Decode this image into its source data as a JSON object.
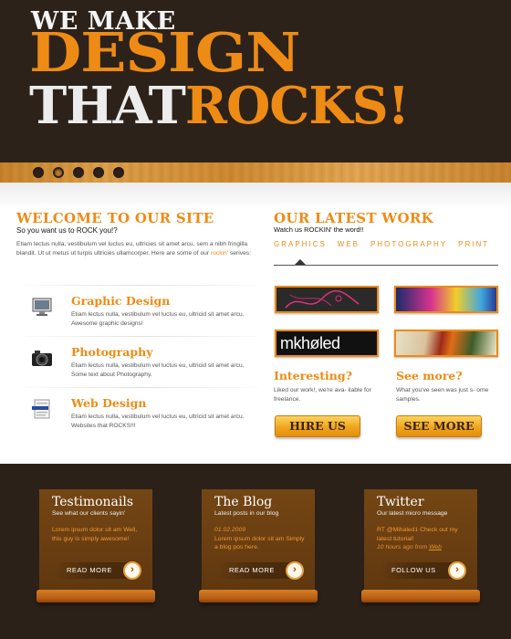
{
  "hero": {
    "line1": "WE MAKE",
    "line2": "DESIGN",
    "line3_white": "THAT",
    "line3_orange": "ROCKS!"
  },
  "slider": {
    "dots": 5,
    "active": 2
  },
  "welcome": {
    "title": "WELCOME TO OUR SITE",
    "subtitle": "So you want us to ROCK you!?",
    "body1": "Etiam lectus nulla, vestibulum vel luctus eu, ultricies sit amet arcu. sem a nibh fringilla blandit. Ut ut metus ut turpis ultricies ullamcorper. Here are some of our ",
    "body_rock": "rockin'",
    "body2": " serives:"
  },
  "services": [
    {
      "title": "Graphic Design",
      "desc": "Etiam lectus nulla, vestibulum vel luctus eu, ultricid sit amet arcu. Awesome graphic designs!",
      "icon": "monitor-icon"
    },
    {
      "title": "Photography",
      "desc": "Etiam lectus nulla, vestibulum vel luctus eu, ultricid sit amet arcu. Some text about Photography.",
      "icon": "camera-icon"
    },
    {
      "title": "Web Design",
      "desc": "Etiam lectus nulla, vestibulum vel luctus eu, ultricid sit amet arcu. Websites that ROCKS!!!",
      "icon": "webpage-icon"
    }
  ],
  "work": {
    "title": "OUR LATEST WORK",
    "subtitle": "Watch us ROCKIN' the word!!",
    "tabs": [
      "GRAPHICS",
      "WEB",
      "PHOTOGRAPHY",
      "PRINT"
    ],
    "active_tab": 0,
    "thumb3_text": "mkhøled"
  },
  "interesting": {
    "title": "Interesting?",
    "desc": "Liked our work!, we're ava- ilable for freelance.",
    "button": "HIRE US"
  },
  "seemore": {
    "title": "See more?",
    "desc": "What you've seen was just s- ome samples.",
    "button": "SEE MORE"
  },
  "footer": {
    "testimonials": {
      "title": "Testimonails",
      "subtitle": "See what our clients sayin'",
      "body": "Lorem ipsum dolor sit am Well, this guy is simply awesome!",
      "button": "READ MORE"
    },
    "blog": {
      "title": "The Blog",
      "subtitle": "Latest posts in our blog",
      "date": "01.02.2009",
      "body": "Lorem ipsum dolor sit am Simply a blog pos here.",
      "button": "READ MORE"
    },
    "twitter": {
      "title": "Twitter",
      "subtitle": "Our latest micro message",
      "body": "RT @Mihaled1 Check out my latest tutorial!",
      "time": "10 hours ago from ",
      "time_link": "Web",
      "button": "FOLLOW US"
    }
  },
  "colors": {
    "accent": "#ee8b15",
    "dark_bg": "#2d221a",
    "card_brown": "#6a3f18"
  }
}
